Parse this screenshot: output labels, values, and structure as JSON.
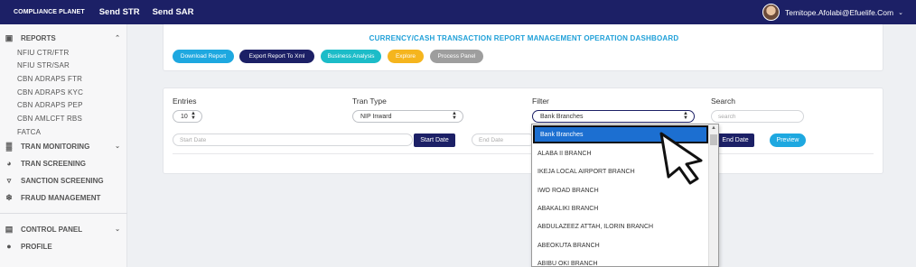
{
  "topbar": {
    "brand": "COMPLIANCE PLANET",
    "links": [
      "Send STR",
      "Send SAR"
    ],
    "user": "Temitope.Afolabi@Efuelife.Com"
  },
  "sidebar": {
    "reports": "REPORTS",
    "report_items": [
      "NFIU CTR/FTR",
      "NFIU STR/SAR",
      "CBN ADRAPS FTR",
      "CBN ADRAPS KYC",
      "CBN ADRAPS PEP",
      "CBN AMLCFT RBS",
      "FATCA"
    ],
    "tran_monitoring": "TRAN MONITORING",
    "tran_screening": "TRAN SCREENING",
    "sanction_screening": "SANCTION SCREENING",
    "fraud_management": "FRAUD MANAGEMENT",
    "control_panel": "CONTROL PANEL",
    "profile": "PROFILE"
  },
  "dashboard": {
    "title": "CURRENCY/CASH TRANSACTION REPORT MANAGEMENT OPERATION DASHBOARD",
    "buttons": [
      "Download Report",
      "Export Report To Xml",
      "Business Analysis",
      "Explore",
      "Process Panel"
    ]
  },
  "filters": {
    "entries_label": "Entries",
    "entries_value": "10",
    "tran_type_label": "Tran Type",
    "tran_type_value": "NIP Inward",
    "filter_label": "Filter",
    "filter_value": "Bank Branches",
    "search_label": "Search",
    "search_placeholder": "search",
    "start_date_placeholder": "Start Date",
    "start_date_button": "Start Date",
    "end_date_placeholder": "End Date",
    "end_date_button": "End Date",
    "preview_button": "Preview"
  },
  "dropdown": {
    "options": [
      "Bank Branches",
      "ALABA II BRANCH",
      "IKEJA LOCAL AIRPORT BRANCH",
      "IWO ROAD BRANCH",
      "ABAKALIKI BRANCH",
      "ABDULAZEEZ ATTAH, ILORIN BRANCH",
      "ABEOKUTA BRANCH",
      "ABIBU OKI BRANCH"
    ]
  },
  "colors": {
    "navy": "#1c2066",
    "accent_blue": "#1fa0d8",
    "explore": "#f5b51e",
    "process": "#9e9e9e",
    "highlight": "#1c6fd1"
  }
}
